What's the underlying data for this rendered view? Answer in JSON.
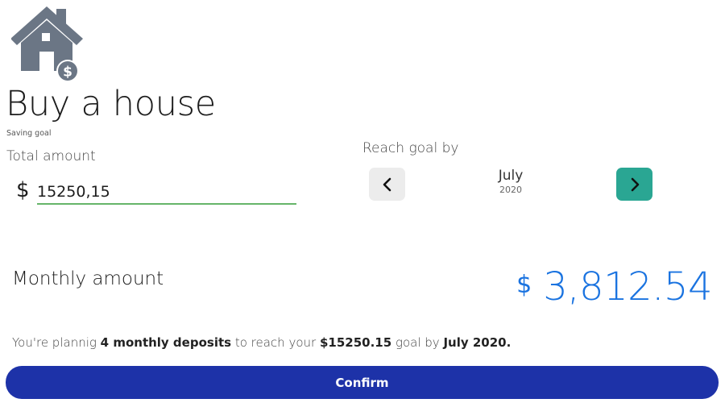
{
  "goal": {
    "icon": "house-dollar-icon",
    "title": "Buy a house",
    "subtitle": "Saving goal"
  },
  "total_amount": {
    "label": "Total amount",
    "currency_symbol": "$",
    "value": "15250,15"
  },
  "reach_goal": {
    "label": "Reach goal by",
    "prev_icon": "chevron-left-icon",
    "next_icon": "chevron-right-icon",
    "month": "July",
    "year": "2020"
  },
  "monthly": {
    "label": "Monthly amount",
    "currency_symbol": "$",
    "value": "3,812.54"
  },
  "summary": {
    "prefix": "You're plannig",
    "deposits": "4 monthly deposits",
    "middle": "to reach your",
    "amount": "$15250.15",
    "goal_by": "goal by",
    "date": "July 2020."
  },
  "confirm_label": "Confirm",
  "colors": {
    "icon_gray": "#6b7685",
    "accent_green": "#2aa693",
    "input_underline": "#66b56a",
    "monthly_blue": "#1a73e0",
    "confirm_blue": "#1d32a8"
  }
}
